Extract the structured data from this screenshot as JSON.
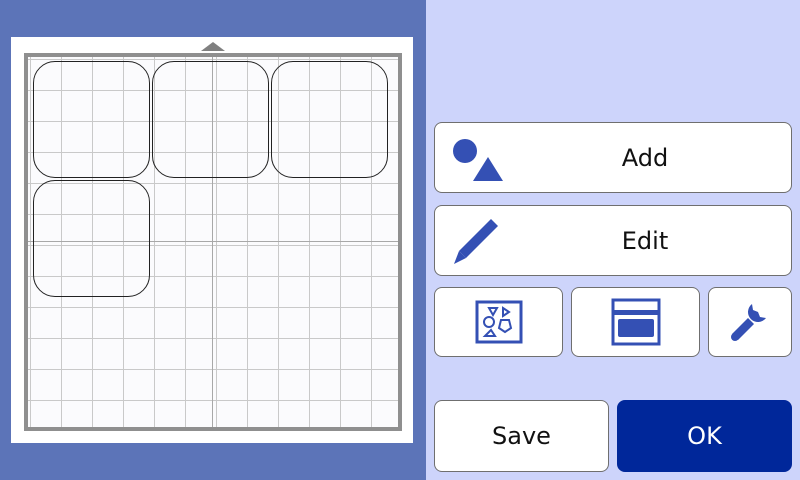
{
  "toolbar": {
    "add_label": "Add",
    "edit_label": "Edit",
    "layout_icon": "pattern-layout-icon",
    "scan_icon": "scanner-icon",
    "settings_icon": "wrench-icon"
  },
  "footer": {
    "save_label": "Save",
    "ok_label": "OK"
  },
  "mat": {
    "shape": "rounded-square",
    "shape_count": 4
  },
  "colors": {
    "accent": "#00279a",
    "icon": "#3450b4",
    "left_panel": "#5c74b8",
    "right_panel": "#cdd4fb"
  }
}
